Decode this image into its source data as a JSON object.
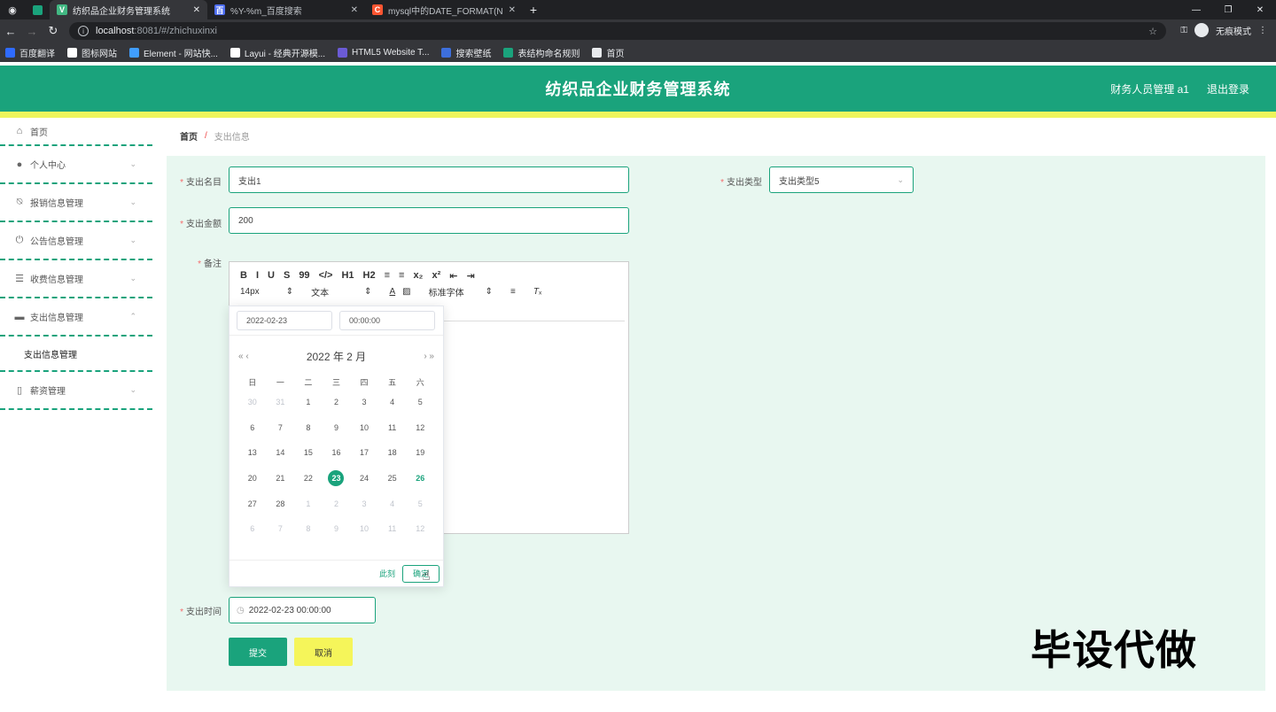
{
  "browser": {
    "tabs": [
      {
        "title": "纺织品企业财务管理系统",
        "favicon": "V",
        "color": "#42b883",
        "active": true
      },
      {
        "title": "%Y-%m_百度搜索",
        "favicon": "百",
        "color": "#4e6ef2",
        "active": false
      },
      {
        "title": "mysql中的DATE_FORMAT(NOW...",
        "favicon": "C",
        "color": "#fc5531",
        "active": false
      }
    ],
    "url_host": "localhost",
    "url_path": ":8081/#/zhichuxinxi",
    "incognito_label": "无痕模式",
    "bookmarks": [
      {
        "label": "百度翻译",
        "color": "#2f6bff"
      },
      {
        "label": "图标网站",
        "color": "#ffffff"
      },
      {
        "label": "Element - 网站快...",
        "color": "#409eff"
      },
      {
        "label": "Layui - 经典开源模...",
        "color": "#ffffff"
      },
      {
        "label": "HTML5 Website T...",
        "color": "#6b5bd6"
      },
      {
        "label": "搜索壁纸",
        "color": "#3d6fdc"
      },
      {
        "label": "表结构命名规则",
        "color": "#1aa37c"
      },
      {
        "label": "首页",
        "color": "#e8eaed"
      }
    ]
  },
  "header": {
    "title": "纺织品企业财务管理系统",
    "user": "财务人员管理 a1",
    "logout": "退出登录"
  },
  "sidebar": {
    "items": [
      {
        "label": "首页",
        "icon": "home-icon",
        "glyph": "⌂",
        "arrow": ""
      },
      {
        "label": "个人中心",
        "icon": "user-icon",
        "glyph": "●",
        "arrow": "⌄"
      },
      {
        "label": "报销信息管理",
        "icon": "bell-off-icon",
        "glyph": "⍉",
        "arrow": "⌄"
      },
      {
        "label": "公告信息管理",
        "icon": "power-icon",
        "glyph": "⏻",
        "arrow": "⌄"
      },
      {
        "label": "收费信息管理",
        "icon": "list-icon",
        "glyph": "☰",
        "arrow": "⌄"
      },
      {
        "label": "支出信息管理",
        "icon": "briefcase-icon",
        "glyph": "▬",
        "arrow": "⌃"
      }
    ],
    "sub_item": "支出信息管理",
    "last_item": {
      "label": "薪资管理",
      "icon": "phone-icon",
      "glyph": "▯",
      "arrow": "⌄"
    }
  },
  "breadcrumb": {
    "home": "首页",
    "sep": "/",
    "current": "支出信息"
  },
  "form": {
    "name_label": "支出名目",
    "name_value": "支出1",
    "type_label": "支出类型",
    "type_value": "支出类型5",
    "amount_label": "支出金额",
    "amount_value": "200",
    "note_label": "备注",
    "time_label": "支出时间",
    "time_value": "2022-02-23 00:00:00",
    "submit": "提交",
    "cancel": "取消"
  },
  "editor": {
    "row1": [
      "B",
      "I",
      "U",
      "S",
      "99",
      "</>",
      "H1",
      "H2",
      "≡",
      "≡",
      "x₂",
      "x²",
      "⇤",
      "⇥"
    ],
    "font_size": "14px",
    "text_type": "文本",
    "font_family": "标准字体"
  },
  "picker": {
    "date_input": "2022-02-23",
    "time_input": "00:00:00",
    "month_title": "2022 年  2 月",
    "weekdays": [
      "日",
      "一",
      "二",
      "三",
      "四",
      "五",
      "六"
    ],
    "days": [
      {
        "d": "30",
        "t": "other"
      },
      {
        "d": "31",
        "t": "other"
      },
      {
        "d": "1",
        "t": ""
      },
      {
        "d": "2",
        "t": ""
      },
      {
        "d": "3",
        "t": ""
      },
      {
        "d": "4",
        "t": ""
      },
      {
        "d": "5",
        "t": ""
      },
      {
        "d": "6",
        "t": ""
      },
      {
        "d": "7",
        "t": ""
      },
      {
        "d": "8",
        "t": ""
      },
      {
        "d": "9",
        "t": ""
      },
      {
        "d": "10",
        "t": ""
      },
      {
        "d": "11",
        "t": ""
      },
      {
        "d": "12",
        "t": ""
      },
      {
        "d": "13",
        "t": ""
      },
      {
        "d": "14",
        "t": ""
      },
      {
        "d": "15",
        "t": ""
      },
      {
        "d": "16",
        "t": ""
      },
      {
        "d": "17",
        "t": ""
      },
      {
        "d": "18",
        "t": ""
      },
      {
        "d": "19",
        "t": ""
      },
      {
        "d": "20",
        "t": ""
      },
      {
        "d": "21",
        "t": ""
      },
      {
        "d": "22",
        "t": ""
      },
      {
        "d": "23",
        "t": "sel"
      },
      {
        "d": "24",
        "t": ""
      },
      {
        "d": "25",
        "t": ""
      },
      {
        "d": "26",
        "t": "today"
      },
      {
        "d": "27",
        "t": ""
      },
      {
        "d": "28",
        "t": ""
      },
      {
        "d": "1",
        "t": "other"
      },
      {
        "d": "2",
        "t": "other"
      },
      {
        "d": "3",
        "t": "other"
      },
      {
        "d": "4",
        "t": "other"
      },
      {
        "d": "5",
        "t": "other"
      },
      {
        "d": "6",
        "t": "other"
      },
      {
        "d": "7",
        "t": "other"
      },
      {
        "d": "8",
        "t": "other"
      },
      {
        "d": "9",
        "t": "other"
      },
      {
        "d": "10",
        "t": "other"
      },
      {
        "d": "11",
        "t": "other"
      },
      {
        "d": "12",
        "t": "other"
      }
    ],
    "now_label": "此刻",
    "ok_label": "确定"
  },
  "watermark": "毕设代做",
  "colors": {
    "primary": "#1aa37c",
    "accent_yellow": "#f5f55a",
    "panel_bg": "#e8f7f0"
  }
}
